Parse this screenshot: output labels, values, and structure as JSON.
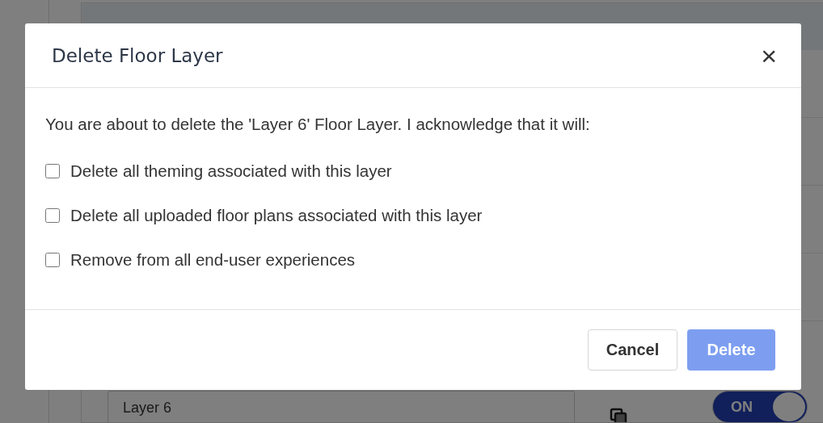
{
  "background": {
    "table": {
      "rows": [
        {
          "name": "Layer 6",
          "toggle": {
            "on": true,
            "label": "ON"
          }
        }
      ]
    }
  },
  "dialog": {
    "title": "Delete Floor Layer",
    "close": "×",
    "message": "You are about to delete the 'Layer 6' Floor Layer. I acknowledge that it will:",
    "items": [
      {
        "label": "Delete all theming associated with this layer",
        "checked": false
      },
      {
        "label": "Delete all uploaded floor plans associated with this layer",
        "checked": false
      },
      {
        "label": "Remove from all end-user experiences",
        "checked": false
      }
    ],
    "buttons": [
      {
        "label": "Cancel",
        "kind": "secondary",
        "disabled": false
      },
      {
        "label": "Delete",
        "kind": "primary",
        "disabled": true
      }
    ]
  }
}
